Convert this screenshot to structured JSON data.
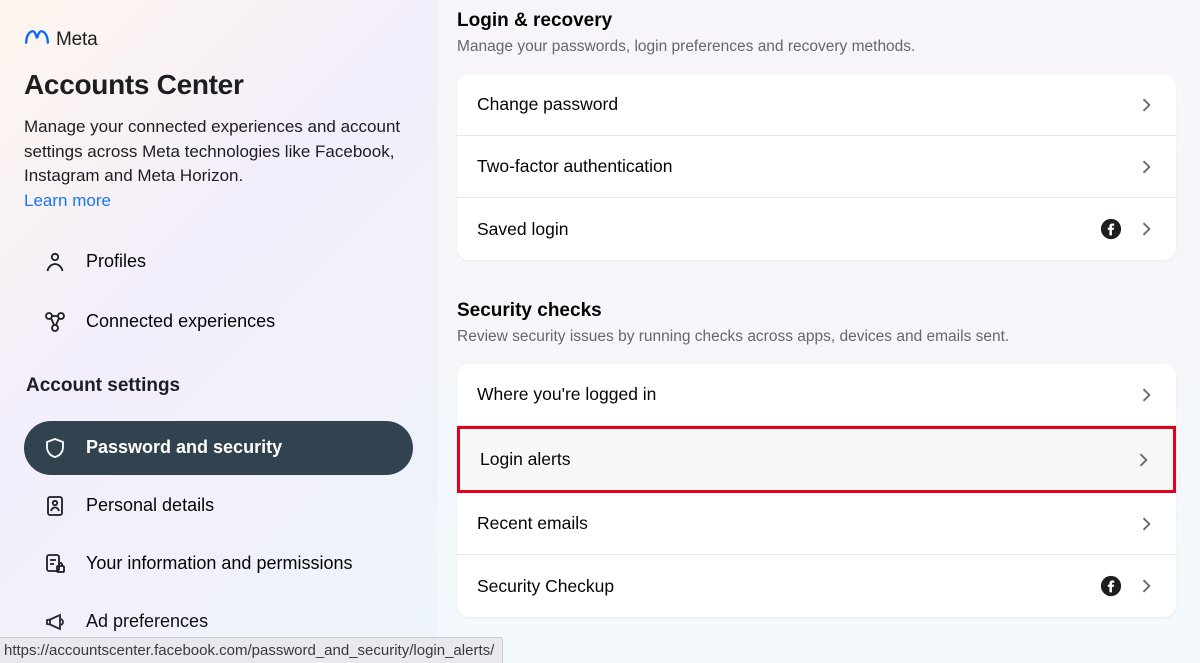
{
  "brand": {
    "name": "Meta"
  },
  "header": {
    "title": "Accounts Center",
    "description": "Manage your connected experiences and account settings across Meta technologies like Facebook, Instagram and Meta Horizon.",
    "learn_more": "Learn more"
  },
  "sidebar": {
    "top_items": [
      {
        "label": "Profiles",
        "name": "sidebar-item-profiles"
      },
      {
        "label": "Connected experiences",
        "name": "sidebar-item-connected-experiences"
      }
    ],
    "section_heading": "Account settings",
    "settings_items": [
      {
        "label": "Password and security",
        "name": "sidebar-item-password-security",
        "active": true
      },
      {
        "label": "Personal details",
        "name": "sidebar-item-personal-details"
      },
      {
        "label": "Your information and permissions",
        "name": "sidebar-item-info-permissions"
      },
      {
        "label": "Ad preferences",
        "name": "sidebar-item-ad-preferences"
      }
    ]
  },
  "main": {
    "sections": [
      {
        "title": "Login & recovery",
        "description": "Manage your passwords, login preferences and recovery methods.",
        "rows": [
          {
            "label": "Change password",
            "showFb": false
          },
          {
            "label": "Two-factor authentication",
            "showFb": false
          },
          {
            "label": "Saved login",
            "showFb": true
          }
        ]
      },
      {
        "title": "Security checks",
        "description": "Review security issues by running checks across apps, devices and emails sent.",
        "rows": [
          {
            "label": "Where you're logged in",
            "showFb": false
          },
          {
            "label": "Login alerts",
            "showFb": false,
            "highlighted": true
          },
          {
            "label": "Recent emails",
            "showFb": false
          },
          {
            "label": "Security Checkup",
            "showFb": true
          }
        ]
      }
    ]
  },
  "status_bar": "https://accountscenter.facebook.com/password_and_security/login_alerts/"
}
